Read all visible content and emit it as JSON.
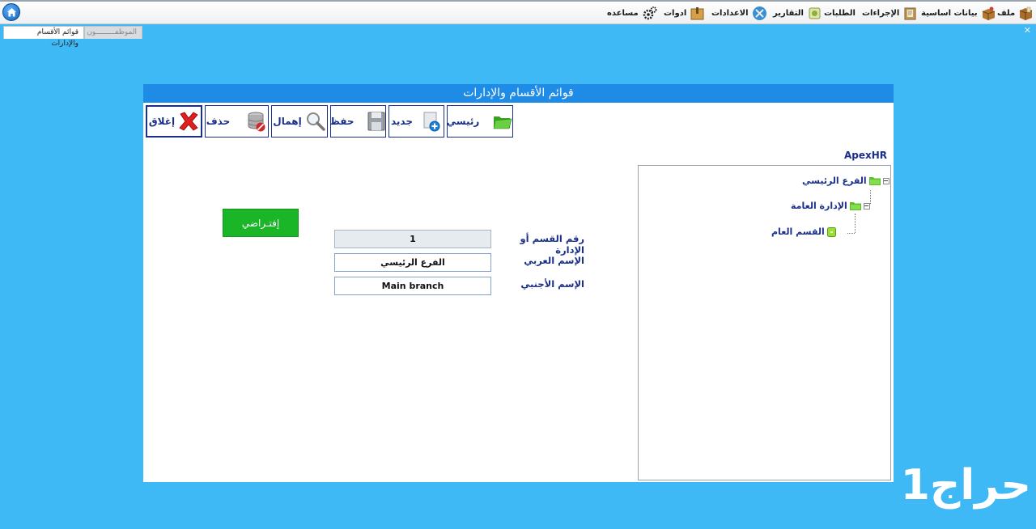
{
  "menubar": {
    "items": [
      {
        "label": "ملف",
        "icon": "file-box-icon"
      },
      {
        "label": "بيانات اساسية",
        "icon": "data-box-icon"
      },
      {
        "label": "الإجراءات",
        "icon": "procedures-icon"
      },
      {
        "label": "الطلبات",
        "icon": "requests-icon"
      },
      {
        "label": "التقارير",
        "icon": "reports-icon"
      },
      {
        "label": "الاعدادات",
        "icon": "settings-tools-icon"
      },
      {
        "label": "ادوات",
        "icon": "tools-box-icon"
      },
      {
        "label": "مساعده",
        "icon": "gears-icon"
      }
    ]
  },
  "tabs": [
    {
      "label": "قوائم الأقسام والإدارات",
      "active": true
    },
    {
      "label": "الموظفـــــــــون",
      "active": false
    }
  ],
  "window": {
    "title": "قوائم الأقسام والإدارات",
    "toolbar": {
      "close_label": "إغلاق",
      "delete_label": "حذف",
      "ignore_label": "إهمال",
      "save_label": "حفظ",
      "new_label": "جديد",
      "main_label": "رئيسي"
    },
    "brand": "ApexHR",
    "tree": {
      "root": "الفرع الرئيسي",
      "child": "الإدارة العامة",
      "grandchild": "القسم العام"
    },
    "form": {
      "code_label": "رقم القسم أو الإدارة",
      "code_value": "1",
      "arabic_label": "الإسم العربي",
      "arabic_value": "الفرع الرئيسي",
      "foreign_label": "الإسم الأجنبي",
      "foreign_value": "Main branch",
      "default_label": "إفتـراضي"
    }
  },
  "watermark": "حراج1",
  "colors": {
    "background": "#3fb9f5",
    "title_bar": "#1e8ce6",
    "label_text": "#1a2f8a",
    "default_button": "#1bb528"
  }
}
